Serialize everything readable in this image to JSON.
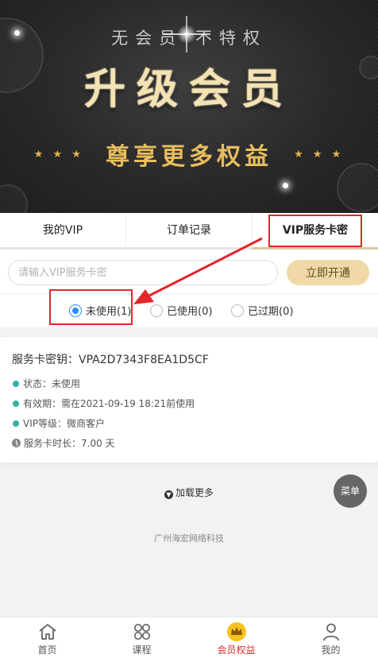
{
  "banner": {
    "slogan": "无会员 不特权",
    "title": "升级会员",
    "subtitle": "尊享更多权益",
    "stars_left": "★ ★ ★",
    "stars_right": "★ ★ ★"
  },
  "tabs": [
    {
      "label": "我的VIP",
      "active": false
    },
    {
      "label": "订单记录",
      "active": false
    },
    {
      "label": "VIP服务卡密",
      "active": true
    }
  ],
  "search": {
    "placeholder": "请输入VIP服务卡密",
    "value": "",
    "button_label": "立即开通"
  },
  "filters": [
    {
      "label": "未使用(1)",
      "selected": true
    },
    {
      "label": "已使用(0)",
      "selected": false
    },
    {
      "label": "已过期(0)",
      "selected": false
    }
  ],
  "card": {
    "key_label": "服务卡密钥：",
    "key_value": "VPA2D7343F8EA1D5CF",
    "status": "状态：未使用",
    "validity": "有效期：需在2021-09-19 18:21前使用",
    "level": "VIP等级：微商客户",
    "duration": "服务卡时长：7.00 天"
  },
  "load_more": "加载更多",
  "menu_button": "菜单",
  "footer": "广州海宏网络科技",
  "bottom_nav": [
    {
      "label": "首页",
      "icon": "home-icon",
      "active": false
    },
    {
      "label": "课程",
      "icon": "grid-icon",
      "active": false
    },
    {
      "label": "会员权益",
      "icon": "crown-icon",
      "active": true
    },
    {
      "label": "我的",
      "icon": "user-icon",
      "active": false
    }
  ],
  "colors": {
    "accent_gold": "#e7bd5e",
    "active_red": "#d4302b",
    "radio_blue": "#2d8cf0",
    "annotation_red": "#e3262c"
  }
}
